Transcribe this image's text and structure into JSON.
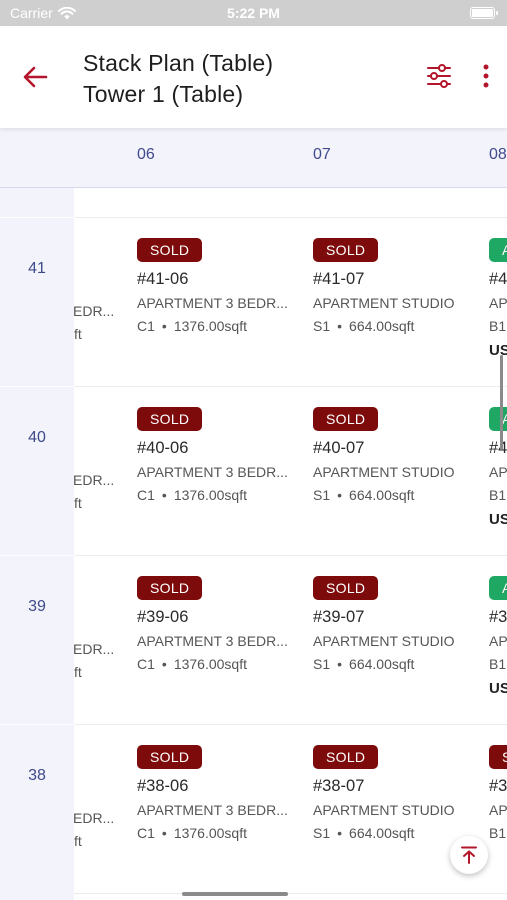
{
  "status_bar": {
    "carrier": "Carrier",
    "time": "5:22 PM"
  },
  "app_bar": {
    "title_line1": "Stack Plan (Table)",
    "title_line2": "Tower 1 (Table)",
    "back_icon": "arrow-left-icon",
    "filter_icon": "sliders-icon",
    "more_icon": "more-vertical-icon"
  },
  "columns": [
    "06",
    "07",
    "08"
  ],
  "rows": [
    {
      "floor": "41",
      "clipped": {
        "type": "EDR...",
        "meta": "ft"
      },
      "units": [
        {
          "status": "SOLD",
          "unit_no": "#41-06",
          "type": "APARTMENT 3 BEDR...",
          "code": "C1",
          "area": "1376.00sqft"
        },
        {
          "status": "SOLD",
          "unit_no": "#41-07",
          "type": "APARTMENT STUDIO",
          "code": "S1",
          "area": "664.00sqft"
        },
        {
          "status": "A",
          "unit_no": "#4",
          "type": "AP",
          "code": "B1",
          "price": "US"
        }
      ]
    },
    {
      "floor": "40",
      "clipped": {
        "type": "EDR...",
        "meta": "ft"
      },
      "units": [
        {
          "status": "SOLD",
          "unit_no": "#40-06",
          "type": "APARTMENT 3 BEDR...",
          "code": "C1",
          "area": "1376.00sqft"
        },
        {
          "status": "SOLD",
          "unit_no": "#40-07",
          "type": "APARTMENT STUDIO",
          "code": "S1",
          "area": "664.00sqft"
        },
        {
          "status": "A",
          "unit_no": "#4",
          "type": "AP",
          "code": "B1",
          "price": "US"
        }
      ]
    },
    {
      "floor": "39",
      "clipped": {
        "type": "EDR...",
        "meta": "ft"
      },
      "units": [
        {
          "status": "SOLD",
          "unit_no": "#39-06",
          "type": "APARTMENT 3 BEDR...",
          "code": "C1",
          "area": "1376.00sqft"
        },
        {
          "status": "SOLD",
          "unit_no": "#39-07",
          "type": "APARTMENT STUDIO",
          "code": "S1",
          "area": "664.00sqft"
        },
        {
          "status": "A",
          "unit_no": "#3",
          "type": "AP",
          "code": "B1",
          "price": "US"
        }
      ]
    },
    {
      "floor": "38",
      "clipped": {
        "type": "EDR...",
        "meta": "ft"
      },
      "units": [
        {
          "status": "SOLD",
          "unit_no": "#38-06",
          "type": "APARTMENT 3 BEDR...",
          "code": "C1",
          "area": "1376.00sqft"
        },
        {
          "status": "SOLD",
          "unit_no": "#38-07",
          "type": "APARTMENT STUDIO",
          "code": "S1",
          "area": "664.00sqft"
        },
        {
          "status": "S",
          "unit_no": "#3",
          "type": "AP",
          "code": "B1",
          "price": ""
        }
      ]
    }
  ],
  "meta_separator": "•",
  "fab_icon": "scroll-to-top-icon",
  "colors": {
    "accent": "#b3162a",
    "sold": "#7d0b0b",
    "available": "#1fa864",
    "header_text": "#3f4a8a",
    "header_bg": "#f3f3fb"
  }
}
